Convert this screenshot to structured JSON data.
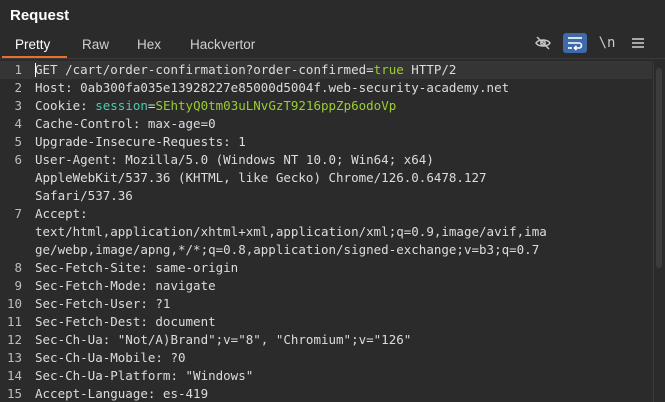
{
  "panel": {
    "title": "Request"
  },
  "tabs": [
    {
      "label": "Pretty",
      "active": true
    },
    {
      "label": "Raw"
    },
    {
      "label": "Hex"
    },
    {
      "label": "Hackvertor"
    }
  ],
  "toolbar": {
    "icons": [
      "eye-slash-icon",
      "wrap-lines-icon",
      "newline-icon",
      "menu-icon"
    ],
    "newline_label": "\\n"
  },
  "colors": {
    "accent": "#e8702a",
    "toggle_active": "#3f6aa8",
    "session_key": "#4ec9b0",
    "value": "#9acd32"
  },
  "request": {
    "lines": [
      {
        "n": "1",
        "key": "GET /cart/order-confirmation?order-confirmed",
        "eq": "=",
        "val": "true",
        "rest": " HTTP/2"
      },
      {
        "n": "2",
        "text": "Host: 0ab300fa035e13928227e85000d5004f.web-security-academy.net"
      },
      {
        "n": "3",
        "key": "Cookie: ",
        "session": "session",
        "eq": "=",
        "val": "SEhtyQ0tm03uLNvGzT9216ppZp6odoVp"
      },
      {
        "n": "4",
        "text": "Cache-Control: max-age=0"
      },
      {
        "n": "5",
        "text": "Upgrade-Insecure-Requests: 1"
      },
      {
        "n": "6",
        "text": "User-Agent: Mozilla/5.0 (Windows NT 10.0; Win64; x64)"
      },
      {
        "n": "",
        "text": "AppleWebKit/537.36 (KHTML, like Gecko) Chrome/126.0.6478.127"
      },
      {
        "n": "",
        "text": "Safari/537.36"
      },
      {
        "n": "7",
        "text": "Accept:"
      },
      {
        "n": "",
        "text": "text/html,application/xhtml+xml,application/xml;q=0.9,image/avif,ima"
      },
      {
        "n": "",
        "text": "ge/webp,image/apng,*/*;q=0.8,application/signed-exchange;v=b3;q=0.7"
      },
      {
        "n": "8",
        "text": "Sec-Fetch-Site: same-origin"
      },
      {
        "n": "9",
        "text": "Sec-Fetch-Mode: navigate"
      },
      {
        "n": "10",
        "text": "Sec-Fetch-User: ?1"
      },
      {
        "n": "11",
        "text": "Sec-Fetch-Dest: document"
      },
      {
        "n": "12",
        "text": "Sec-Ch-Ua: \"Not/A)Brand\";v=\"8\", \"Chromium\";v=\"126\""
      },
      {
        "n": "13",
        "text": "Sec-Ch-Ua-Mobile: ?0"
      },
      {
        "n": "14",
        "text": "Sec-Ch-Ua-Platform: \"Windows\""
      },
      {
        "n": "15",
        "text": "Accept-Language: es-419"
      }
    ]
  }
}
